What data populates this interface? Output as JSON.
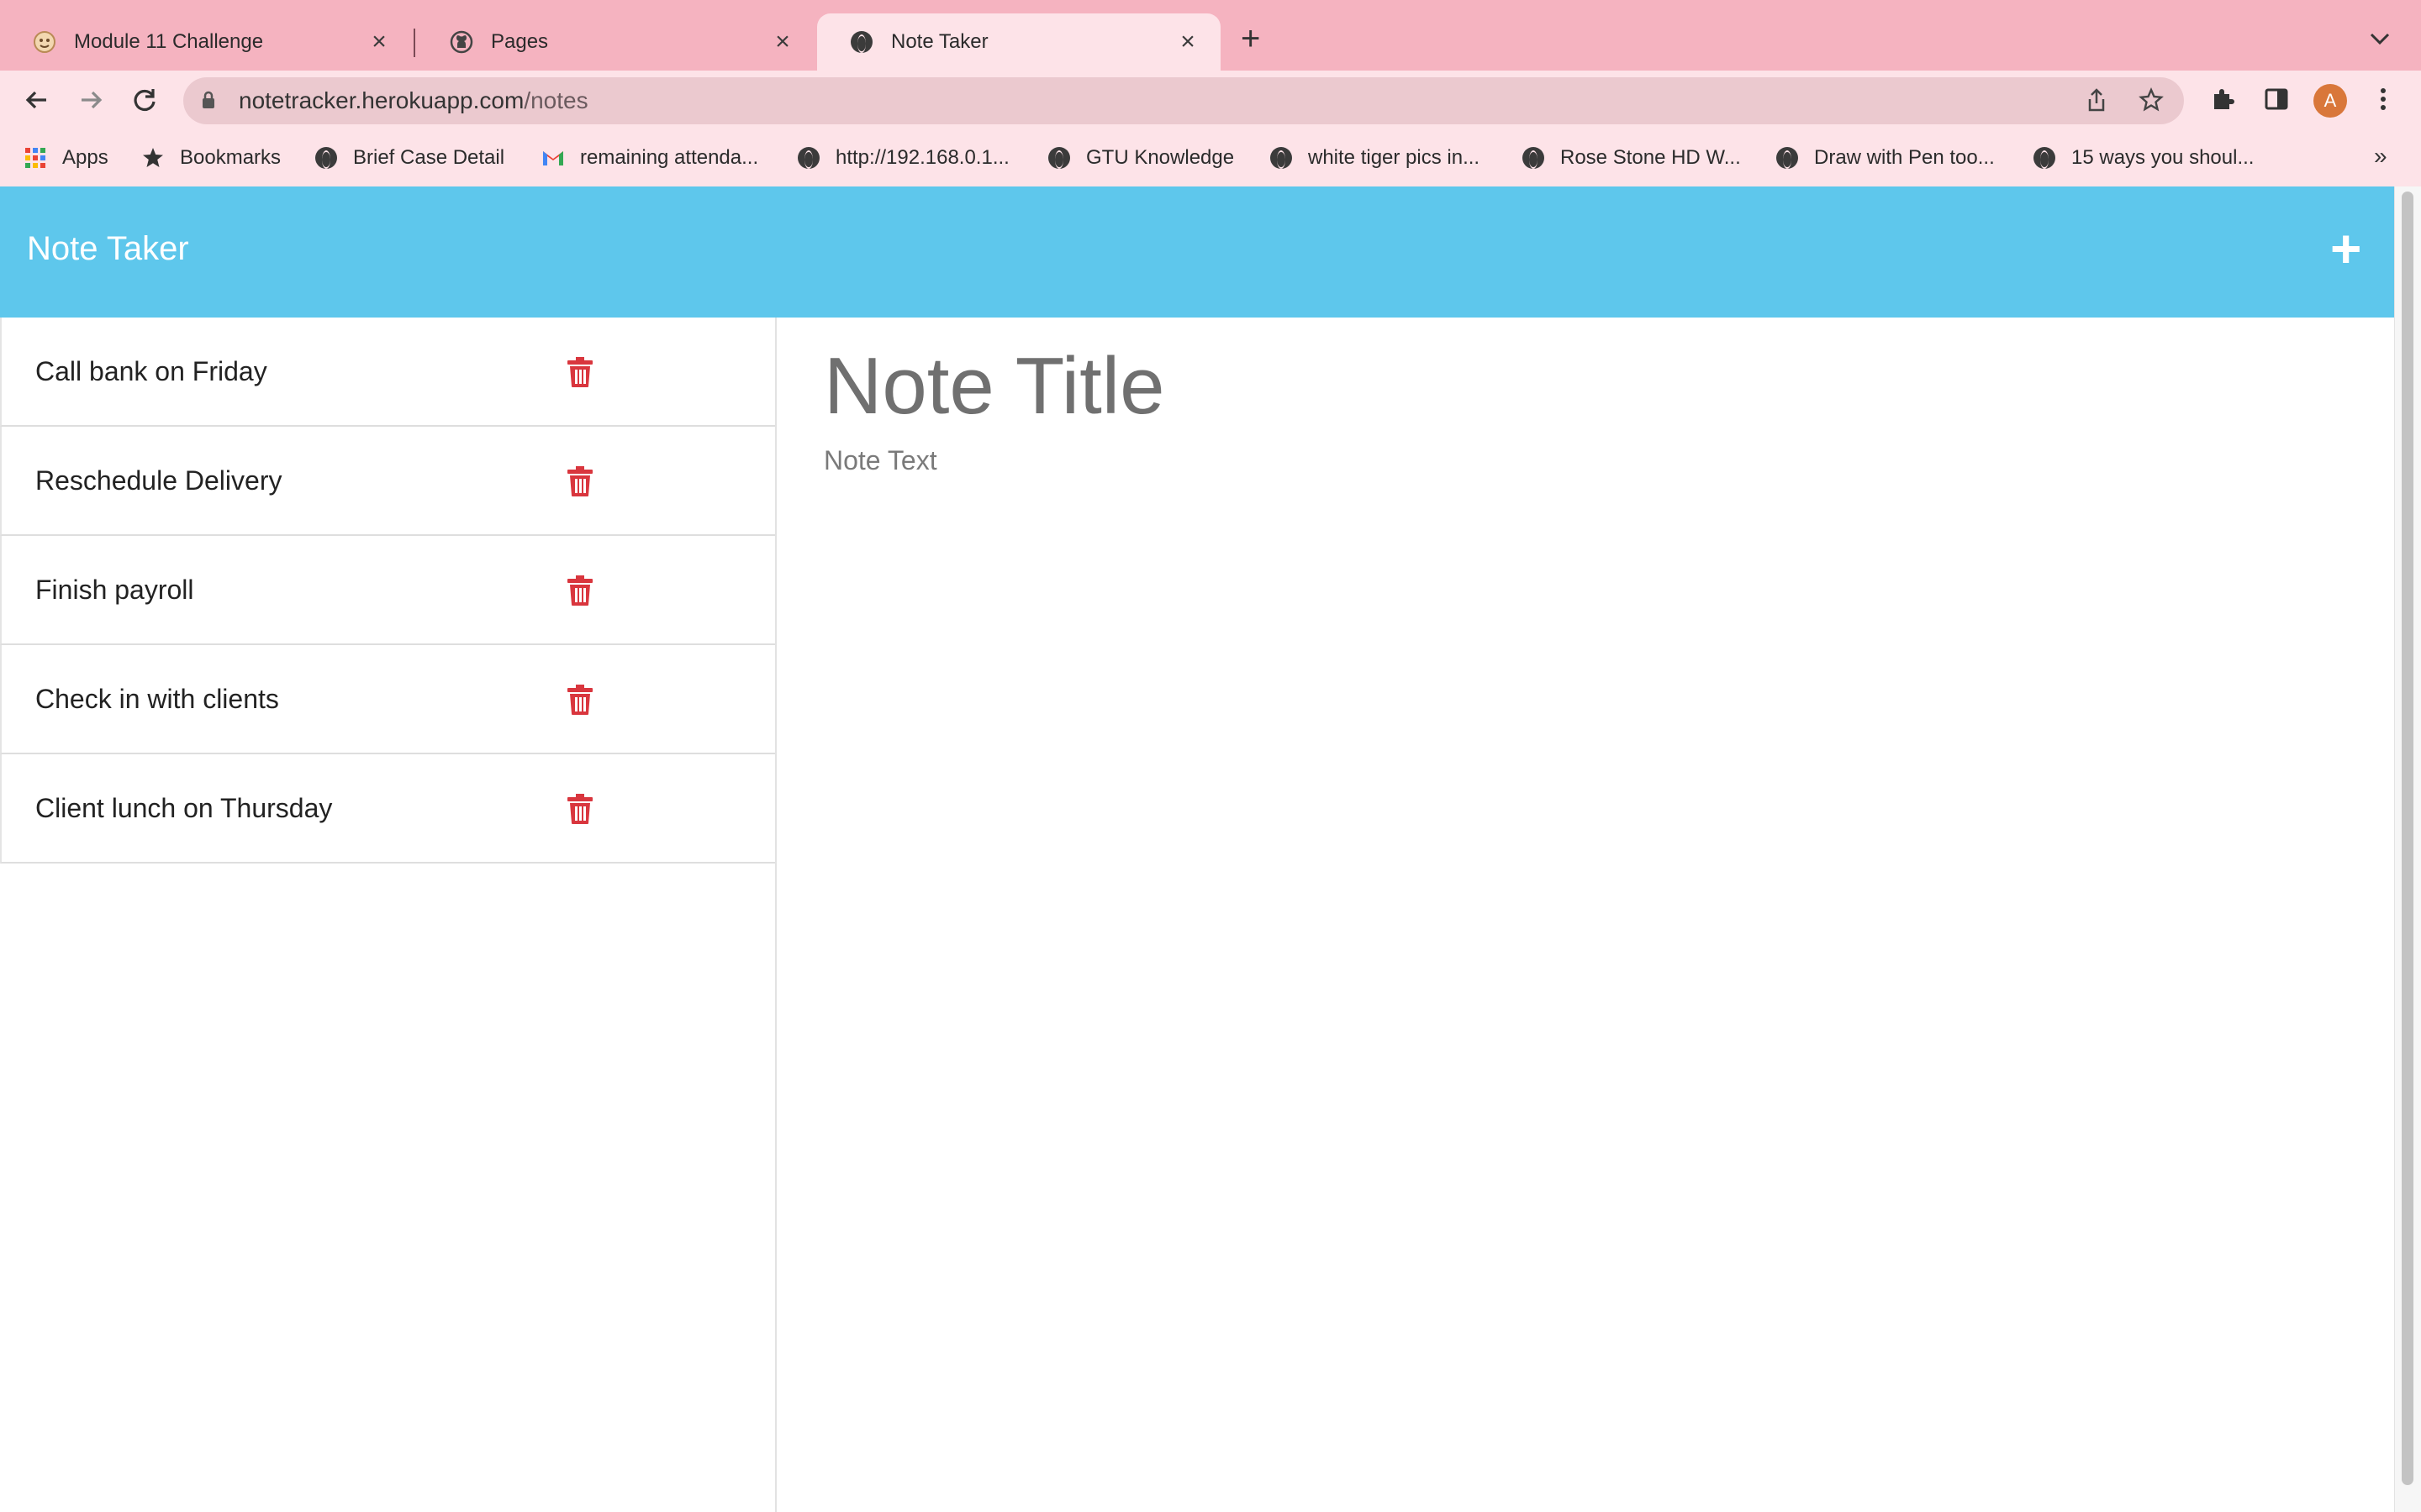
{
  "browser": {
    "tabs": [
      {
        "label": "Module 11 Challenge",
        "icon": "emoji-favicon-icon",
        "active": false
      },
      {
        "label": "Pages",
        "icon": "github-icon",
        "active": false
      },
      {
        "label": "Note Taker",
        "icon": "globe-icon",
        "active": true
      }
    ],
    "url_host": "notetracker.herokuapp.com",
    "url_path": "/notes",
    "avatar_initial": "A",
    "bookmarks": [
      {
        "label": "Apps",
        "icon": "apps-grid-icon"
      },
      {
        "label": "Bookmarks",
        "icon": "star-icon"
      },
      {
        "label": "Brief Case Detail",
        "icon": "globe-icon"
      },
      {
        "label": "remaining attenda...",
        "icon": "gmail-icon"
      },
      {
        "label": "http://192.168.0.1...",
        "icon": "globe-icon"
      },
      {
        "label": "GTU Knowledge",
        "icon": "globe-icon"
      },
      {
        "label": "white tiger pics in...",
        "icon": "globe-icon"
      },
      {
        "label": "Rose Stone HD W...",
        "icon": "globe-icon"
      },
      {
        "label": "Draw with Pen too...",
        "icon": "globe-icon"
      },
      {
        "label": "15 ways you shoul...",
        "icon": "globe-icon"
      }
    ],
    "more_bookmarks": "»"
  },
  "app": {
    "brand": "Note Taker",
    "add_label": "+",
    "notes": [
      {
        "title": "Call bank on Friday"
      },
      {
        "title": "Reschedule Delivery"
      },
      {
        "title": "Finish payroll"
      },
      {
        "title": "Check in with clients"
      },
      {
        "title": "Client lunch on Thursday"
      }
    ],
    "editor": {
      "title_placeholder": "Note Title",
      "text_placeholder": "Note Text"
    },
    "colors": {
      "header": "#5ec7ec",
      "trash": "#d9363e",
      "chrome": "#f5b3c0"
    }
  }
}
